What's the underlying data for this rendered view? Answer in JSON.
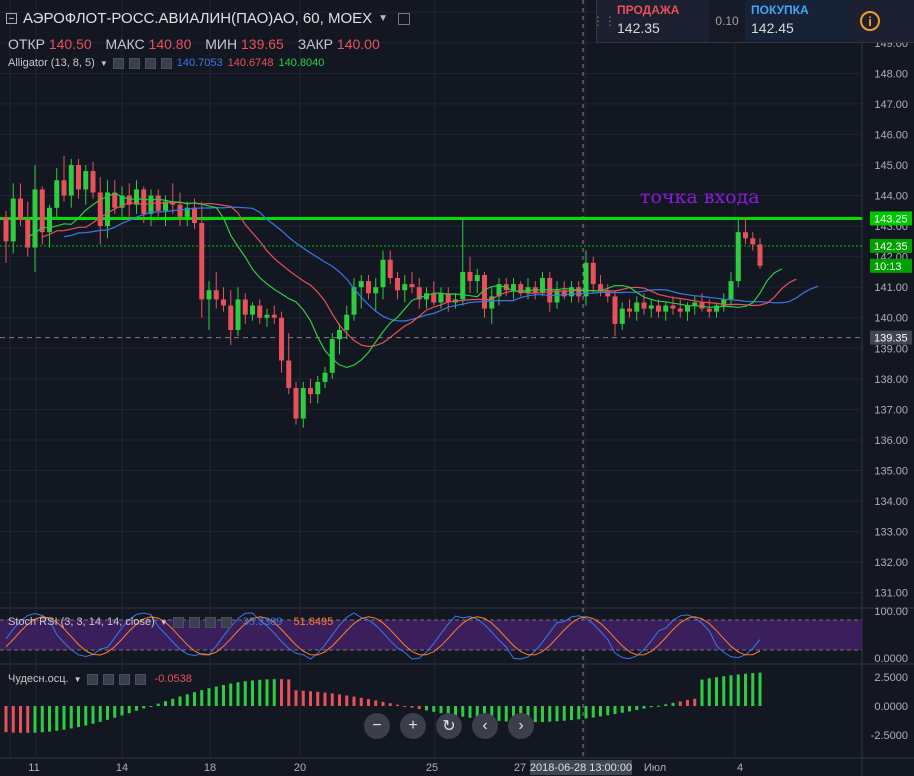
{
  "header": {
    "title": "АЭРОФЛОТ-РОСС.АВИАЛИН(ПАО)АО, 60, MOEX"
  },
  "ohlc": {
    "open_label": "ОТКР",
    "open": "140.50",
    "high_label": "МАКС",
    "high": "140.80",
    "low_label": "МИН",
    "low": "139.65",
    "close_label": "ЗАКР",
    "close": "140.00"
  },
  "alligator": {
    "label": "Alligator (13, 8, 5)",
    "jaw": "140.7053",
    "teeth": "140.6748",
    "lips": "140.8040",
    "colors": {
      "jaw": "#3b78e7",
      "teeth": "#e8505b",
      "lips": "#2ecc40"
    }
  },
  "stoch": {
    "label": "Stoch RSI (3, 3, 14, 14, close)",
    "k": "35.3389",
    "d": "51.8495",
    "colors": {
      "k": "#3b78e7",
      "d": "#ff7f2a"
    }
  },
  "ao": {
    "label": "Чудесн.осц.",
    "value": "-0.0538"
  },
  "trade": {
    "sell_label": "ПРОДАЖА",
    "sell": "142.35",
    "spread": "0.10",
    "buy_label": "ПОКУПКА",
    "buy": "142.45",
    "info": "i"
  },
  "annotation": "точка входа",
  "price_axis": {
    "ticks": [
      "150.00",
      "149.00",
      "148.00",
      "147.00",
      "146.00",
      "145.00",
      "144.00",
      "143.00",
      "142.00",
      "141.00",
      "140.00",
      "139.00",
      "138.00",
      "137.00",
      "136.00",
      "135.00",
      "134.00",
      "133.00",
      "132.00",
      "131.00"
    ],
    "labels": [
      {
        "text": "143.25",
        "price": 143.25,
        "bg": "#00c800"
      },
      {
        "text": "142.35",
        "price": 142.35,
        "bg": "#00a000"
      },
      {
        "text": "10:13",
        "price": 141.7,
        "bg": "#00a000"
      },
      {
        "text": "139.35",
        "price": 139.35,
        "bg": "#404552"
      }
    ],
    "lines": [
      {
        "price": 143.25,
        "color": "#00e000",
        "style": "solid"
      },
      {
        "price": 142.35,
        "color": "#00c000",
        "style": "dotted"
      },
      {
        "price": 139.35,
        "color": "#808080",
        "style": "dashed"
      }
    ]
  },
  "stoch_axis": {
    "ticks": [
      "100.00",
      "0.0000"
    ]
  },
  "ao_axis": {
    "ticks": [
      "2.5000",
      "0.0000",
      "-2.5000"
    ]
  },
  "time_axis": {
    "ticks": [
      {
        "label": "11",
        "day": 0.5
      },
      {
        "label": "14",
        "day": 3
      },
      {
        "label": "18",
        "day": 5
      },
      {
        "label": "20",
        "day": 7
      },
      {
        "label": "25",
        "day": 10
      },
      {
        "label": "27",
        "day": 12
      },
      {
        "label": "Июл",
        "day": 15
      },
      {
        "label": "4",
        "day": 17
      }
    ],
    "crosshair": "2018-06-28 13:00:00"
  },
  "chart_data": {
    "type": "candlestick",
    "y_range": [
      130.5,
      150.4
    ],
    "candles": [
      [
        143.3,
        143.5,
        141.8,
        142.5
      ],
      [
        142.5,
        144.4,
        142.1,
        143.9
      ],
      [
        143.9,
        144.4,
        143.0,
        143.2
      ],
      [
        143.2,
        143.8,
        142.0,
        142.3
      ],
      [
        142.3,
        145.0,
        141.5,
        144.2
      ],
      [
        144.2,
        144.3,
        142.4,
        142.8
      ],
      [
        142.8,
        143.7,
        142.3,
        143.6
      ],
      [
        143.6,
        144.9,
        143.3,
        144.5
      ],
      [
        144.5,
        145.3,
        143.8,
        144.0
      ],
      [
        144.0,
        145.2,
        143.6,
        145.0
      ],
      [
        145.0,
        145.2,
        143.9,
        144.2
      ],
      [
        144.2,
        145.0,
        143.7,
        144.8
      ],
      [
        144.8,
        145.1,
        143.9,
        144.1
      ],
      [
        144.1,
        144.6,
        142.4,
        143.0
      ],
      [
        143.0,
        144.5,
        142.6,
        144.1
      ],
      [
        144.1,
        144.5,
        143.4,
        143.6
      ],
      [
        143.6,
        144.3,
        143.3,
        144.0
      ],
      [
        144.0,
        144.4,
        143.2,
        143.7
      ],
      [
        143.7,
        144.5,
        143.4,
        144.2
      ],
      [
        144.2,
        144.3,
        143.1,
        143.4
      ],
      [
        143.4,
        144.2,
        143.0,
        144.0
      ],
      [
        144.0,
        144.2,
        143.3,
        143.5
      ],
      [
        143.5,
        144.0,
        143.0,
        143.8
      ],
      [
        143.8,
        144.4,
        143.4,
        143.7
      ],
      [
        143.7,
        144.1,
        143.0,
        143.3
      ],
      [
        143.3,
        143.8,
        143.0,
        143.6
      ],
      [
        143.6,
        143.9,
        142.9,
        143.1
      ],
      [
        143.1,
        143.8,
        140.0,
        140.6
      ],
      [
        140.6,
        141.2,
        139.6,
        140.9
      ],
      [
        140.9,
        141.5,
        140.3,
        140.6
      ],
      [
        140.6,
        141.0,
        140.2,
        140.4
      ],
      [
        140.4,
        140.9,
        139.1,
        139.6
      ],
      [
        139.6,
        141.0,
        139.4,
        140.6
      ],
      [
        140.6,
        140.8,
        139.8,
        140.1
      ],
      [
        140.1,
        140.5,
        139.9,
        140.4
      ],
      [
        140.4,
        140.6,
        139.8,
        140.0
      ],
      [
        140.0,
        140.3,
        139.7,
        140.1
      ],
      [
        140.1,
        140.4,
        139.8,
        140.0
      ],
      [
        140.0,
        140.2,
        138.2,
        138.6
      ],
      [
        138.6,
        139.5,
        137.5,
        137.7
      ],
      [
        137.7,
        137.9,
        136.5,
        136.7
      ],
      [
        136.7,
        137.9,
        136.4,
        137.7
      ],
      [
        137.7,
        138.0,
        137.2,
        137.5
      ],
      [
        137.5,
        138.1,
        137.2,
        137.9
      ],
      [
        137.9,
        138.4,
        137.7,
        138.2
      ],
      [
        138.2,
        139.5,
        138.0,
        139.3
      ],
      [
        139.3,
        139.8,
        138.8,
        139.6
      ],
      [
        139.6,
        140.4,
        139.3,
        140.1
      ],
      [
        140.1,
        141.3,
        139.9,
        141.0
      ],
      [
        141.0,
        141.4,
        140.3,
        141.2
      ],
      [
        141.2,
        141.4,
        140.6,
        140.8
      ],
      [
        140.8,
        141.3,
        140.2,
        141.0
      ],
      [
        141.0,
        142.2,
        140.6,
        141.9
      ],
      [
        141.9,
        142.2,
        141.1,
        141.3
      ],
      [
        141.3,
        141.5,
        140.6,
        140.9
      ],
      [
        140.9,
        141.4,
        140.5,
        141.1
      ],
      [
        141.1,
        141.5,
        140.8,
        141.0
      ],
      [
        141.0,
        141.3,
        140.3,
        140.6
      ],
      [
        140.6,
        141.0,
        140.3,
        140.8
      ],
      [
        140.8,
        141.2,
        140.4,
        140.5
      ],
      [
        140.5,
        141.0,
        140.3,
        140.8
      ],
      [
        140.8,
        141.0,
        140.2,
        140.5
      ],
      [
        140.5,
        140.8,
        140.3,
        140.6
      ],
      [
        140.6,
        143.3,
        140.4,
        141.5
      ],
      [
        141.5,
        142.0,
        140.8,
        141.2
      ],
      [
        141.2,
        141.6,
        140.8,
        141.4
      ],
      [
        141.4,
        141.5,
        140.0,
        140.3
      ],
      [
        140.3,
        141.0,
        139.8,
        140.7
      ],
      [
        140.7,
        141.3,
        140.4,
        141.1
      ],
      [
        141.1,
        141.3,
        140.7,
        140.9
      ],
      [
        140.9,
        141.3,
        140.6,
        141.1
      ],
      [
        141.1,
        141.2,
        140.7,
        140.8
      ],
      [
        140.8,
        141.3,
        140.6,
        141.0
      ],
      [
        141.0,
        141.2,
        140.6,
        140.8
      ],
      [
        140.8,
        141.5,
        140.7,
        141.3
      ],
      [
        141.3,
        141.5,
        140.2,
        140.5
      ],
      [
        140.5,
        141.2,
        140.3,
        140.9
      ],
      [
        140.9,
        141.2,
        140.6,
        140.7
      ],
      [
        140.7,
        141.2,
        140.5,
        141.0
      ],
      [
        141.0,
        141.2,
        140.5,
        140.7
      ],
      [
        140.7,
        142.2,
        140.4,
        141.8
      ],
      [
        141.8,
        142.0,
        140.8,
        141.1
      ],
      [
        141.1,
        141.4,
        140.7,
        140.9
      ],
      [
        140.9,
        141.1,
        140.5,
        140.7
      ],
      [
        140.7,
        140.9,
        139.4,
        139.8
      ],
      [
        139.8,
        140.5,
        139.6,
        140.3
      ],
      [
        140.3,
        140.6,
        140.0,
        140.2
      ],
      [
        140.2,
        140.7,
        139.9,
        140.5
      ],
      [
        140.5,
        140.8,
        140.1,
        140.3
      ],
      [
        140.3,
        140.6,
        140.0,
        140.4
      ],
      [
        140.4,
        140.6,
        140.0,
        140.2
      ],
      [
        140.2,
        140.5,
        139.9,
        140.4
      ],
      [
        140.4,
        140.7,
        140.1,
        140.3
      ],
      [
        140.3,
        140.6,
        140.0,
        140.2
      ],
      [
        140.2,
        140.5,
        139.9,
        140.4
      ],
      [
        140.4,
        140.7,
        140.1,
        140.5
      ],
      [
        140.5,
        140.8,
        140.2,
        140.3
      ],
      [
        140.3,
        140.6,
        140.0,
        140.2
      ],
      [
        140.2,
        140.5,
        140.0,
        140.4
      ],
      [
        140.4,
        140.8,
        140.2,
        140.6
      ],
      [
        140.6,
        141.5,
        140.4,
        141.2
      ],
      [
        141.2,
        143.2,
        141.0,
        142.8
      ],
      [
        142.8,
        143.3,
        142.4,
        142.6
      ],
      [
        142.6,
        142.8,
        142.2,
        142.4
      ],
      [
        142.4,
        142.6,
        141.6,
        141.7
      ]
    ]
  }
}
